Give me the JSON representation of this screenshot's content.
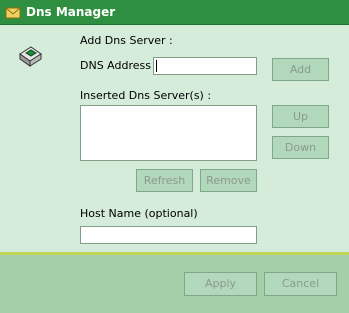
{
  "window": {
    "title": "Dns Manager"
  },
  "section_label": "Add Dns Server :",
  "dns_address": {
    "label": "DNS Address :",
    "value": "",
    "placeholder": ""
  },
  "buttons": {
    "add": "Add",
    "up": "Up",
    "down": "Down",
    "refresh": "Refresh",
    "remove": "Remove",
    "apply": "Apply",
    "cancel": "Cancel"
  },
  "inserted_label": "Inserted Dns Server(s) :",
  "inserted_servers": [],
  "host_name": {
    "label": "Host Name (optional)",
    "value": ""
  },
  "colors": {
    "title_bar": "#2d8f3f",
    "background": "#d4ecd9",
    "footer": "#a5cfa9",
    "divider": "#c2d55a"
  },
  "icons": {
    "window": "mail-envelope-icon",
    "app": "network-chip-icon"
  }
}
